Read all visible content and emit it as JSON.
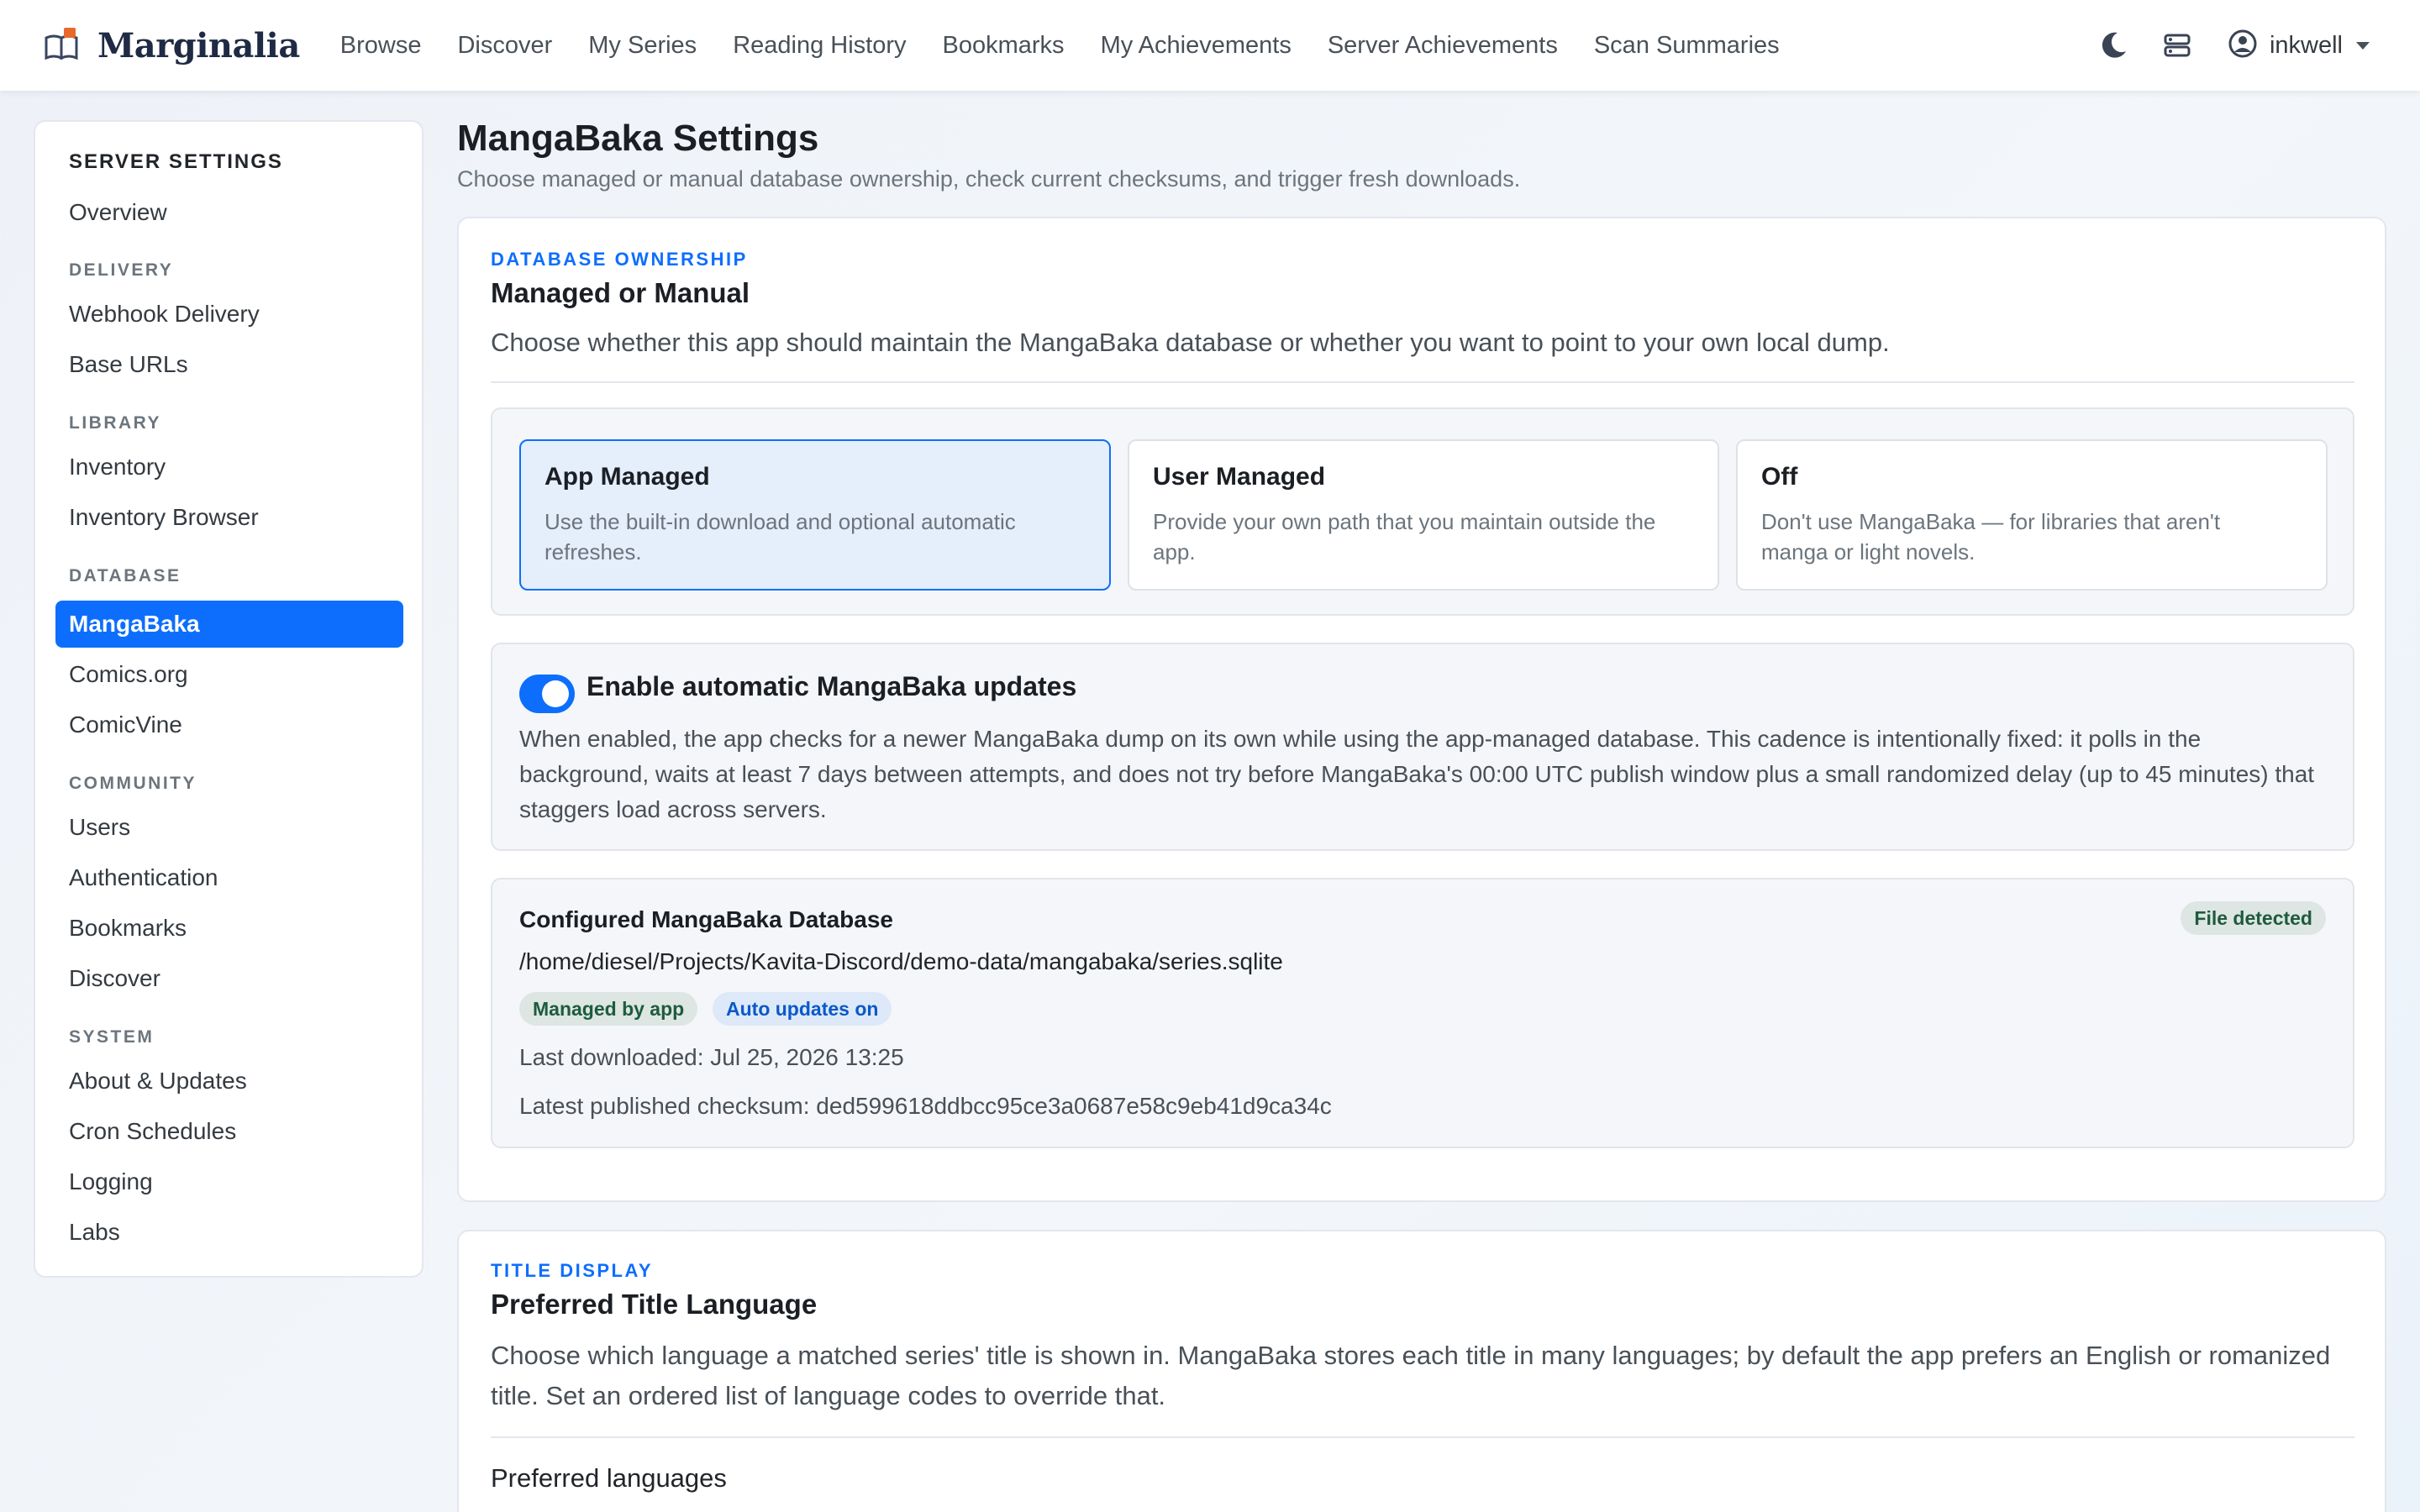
{
  "app": {
    "name": "Marginalia",
    "brand_accent": "#0d6efd"
  },
  "nav": {
    "links": [
      "Browse",
      "Discover",
      "My Series",
      "Reading History",
      "Bookmarks",
      "My Achievements",
      "Server Achievements",
      "Scan Summaries"
    ],
    "user": "inkwell"
  },
  "sidebar": {
    "title": "SERVER SETTINGS",
    "overview": "Overview",
    "sections": {
      "delivery": "DELIVERY",
      "library": "LIBRARY",
      "database": "DATABASE",
      "community": "COMMUNITY",
      "system": "SYSTEM"
    },
    "items": {
      "webhook": "Webhook Delivery",
      "base_urls": "Base URLs",
      "inventory": "Inventory",
      "inventory_browser": "Inventory Browser",
      "mangabaka": "MangaBaka",
      "comics_org": "Comics.org",
      "comicvine": "ComicVine",
      "users": "Users",
      "authentication": "Authentication",
      "bookmarks": "Bookmarks",
      "discover": "Discover",
      "about": "About & Updates",
      "cron": "Cron Schedules",
      "logging": "Logging",
      "labs": "Labs"
    },
    "active": "MangaBaka"
  },
  "page": {
    "title": "MangaBaka Settings",
    "subtitle": "Choose managed or manual database ownership, check current checksums, and trigger fresh downloads."
  },
  "ownership": {
    "eyebrow": "DATABASE OWNERSHIP",
    "title": "Managed or Manual",
    "description": "Choose whether this app should maintain the MangaBaka database or whether you want to point to your own local dump.",
    "options": [
      {
        "title": "App Managed",
        "desc": "Use the built-in download and optional automatic refreshes.",
        "selected": true
      },
      {
        "title": "User Managed",
        "desc": "Provide your own path that you maintain outside the app.",
        "selected": false
      },
      {
        "title": "Off",
        "desc": "Don't use MangaBaka — for libraries that aren't manga or light novels.",
        "selected": false
      }
    ],
    "auto_update": {
      "label": "Enable automatic MangaBaka updates",
      "enabled": true,
      "desc": "When enabled, the app checks for a newer MangaBaka dump on its own while using the app-managed database. This cadence is intentionally fixed: it polls in the background, waits at least 7 days between attempts, and does not try before MangaBaka's 00:00 UTC publish window plus a small randomized delay (up to 45 minutes) that staggers load across servers."
    },
    "database": {
      "title": "Configured MangaBaka Database",
      "status": "File detected",
      "path": "/home/diesel/Projects/Kavita-Discord/demo-data/mangabaka/series.sqlite",
      "badge_managed": "Managed by app",
      "badge_auto": "Auto updates on",
      "last_downloaded": "Last downloaded: Jul 25, 2026 13:25",
      "checksum": "Latest published checksum: ded599618ddbcc95ce3a0687e58c9eb41d9ca34c"
    }
  },
  "title_display": {
    "eyebrow": "TITLE DISPLAY",
    "title": "Preferred Title Language",
    "description": "Choose which language a matched series' title is shown in. MangaBaka stores each title in many languages; by default the app prefers an English or romanized title. Set an ordered list of language codes to override that.",
    "pref_label": "Preferred languages"
  }
}
